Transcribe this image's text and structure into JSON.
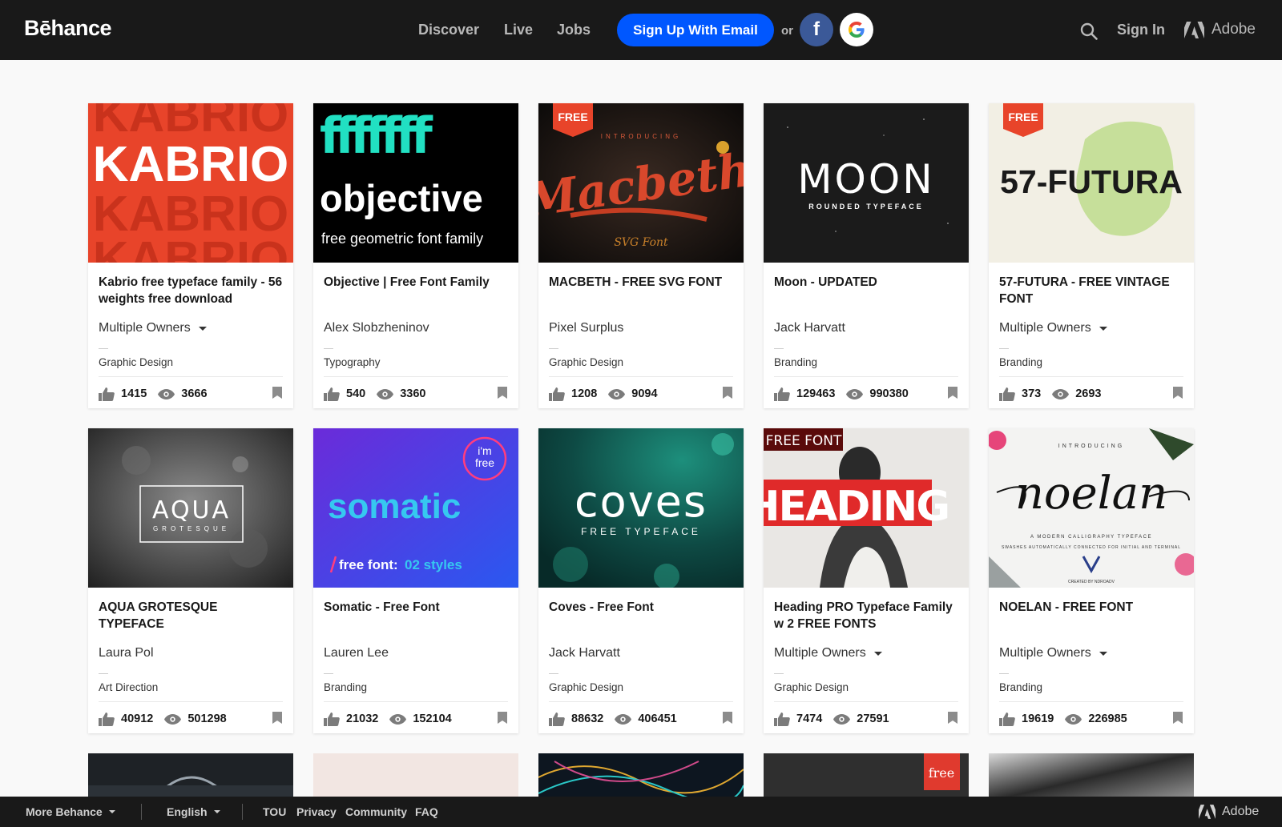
{
  "header": {
    "logo": "Bēhance",
    "nav": [
      "Discover",
      "Live",
      "Jobs"
    ],
    "signup_label": "Sign Up With Email",
    "or_label": "or",
    "facebook_letter": "f",
    "signin_label": "Sign In",
    "adobe_label": "Adobe"
  },
  "projects": [
    {
      "title": "Kabrio free typeface family - 56 weights free download",
      "owner": "Multiple Owners",
      "multiple": true,
      "field": "Graphic Design",
      "likes": "1415",
      "views": "3666",
      "thumb": {
        "lines": [
          "KABRIO"
        ],
        "badge": ""
      }
    },
    {
      "title": "Objective | Free Font Family",
      "owner": "Alex Slobzheninov",
      "multiple": false,
      "field": "Typography",
      "likes": "540",
      "views": "3360",
      "thumb": {
        "lines": [
          "fffffff",
          "objective",
          "free geometric font family"
        ],
        "badge": ""
      }
    },
    {
      "title": "MACBETH - FREE SVG FONT",
      "owner": "Pixel Surplus",
      "multiple": false,
      "field": "Graphic Design",
      "likes": "1208",
      "views": "9094",
      "thumb": {
        "lines": [
          "INTRODUCING",
          "Macbeth",
          "SVG Font"
        ],
        "badge": "FREE"
      }
    },
    {
      "title": "Moon - UPDATED",
      "owner": "Jack Harvatt",
      "multiple": false,
      "field": "Branding",
      "likes": "129463",
      "views": "990380",
      "thumb": {
        "lines": [
          "MOON",
          "ROUNDED TYPEFACE"
        ],
        "badge": ""
      }
    },
    {
      "title": "57-FUTURA - FREE VINTAGE FONT",
      "owner": "Multiple Owners",
      "multiple": true,
      "field": "Branding",
      "likes": "373",
      "views": "2693",
      "thumb": {
        "lines": [
          "57-FUTURA"
        ],
        "badge": "FREE"
      }
    },
    {
      "title": "AQUA GROTESQUE TYPEFACE",
      "owner": "Laura Pol",
      "multiple": false,
      "field": "Art Direction",
      "likes": "40912",
      "views": "501298",
      "thumb": {
        "lines": [
          "AQUA",
          "GROTESQUE"
        ],
        "badge": ""
      }
    },
    {
      "title": "Somatic - Free Font",
      "owner": "Lauren Lee",
      "multiple": false,
      "field": "Branding",
      "likes": "21032",
      "views": "152104",
      "thumb": {
        "lines": [
          "somatic",
          "free font:",
          "02 styles",
          "i'm",
          "free"
        ],
        "badge": ""
      }
    },
    {
      "title": "Coves - Free Font",
      "owner": "Jack Harvatt",
      "multiple": false,
      "field": "Graphic Design",
      "likes": "88632",
      "views": "406451",
      "thumb": {
        "lines": [
          "coves",
          "FREE TYPEFACE"
        ],
        "badge": ""
      }
    },
    {
      "title": "Heading PRO Typeface Family w 2 FREE FONTS",
      "owner": "Multiple Owners",
      "multiple": true,
      "field": "Graphic Design",
      "likes": "7474",
      "views": "27591",
      "thumb": {
        "lines": [
          "HEADING"
        ],
        "badge": "FREE FONT"
      }
    },
    {
      "title": "NOELAN - FREE FONT",
      "owner": "Multiple Owners",
      "multiple": true,
      "field": "Branding",
      "likes": "19619",
      "views": "226985",
      "thumb": {
        "lines": [
          "INTRODUCING",
          "noelan",
          "A MODERN CALLIGRAPHY TYPEFACE",
          "SWASHES AUTOMATICALLY CONNECTED FOR INITIAL AND TERMINAL",
          "CREATED BY NDROADV"
        ],
        "badge": ""
      }
    }
  ],
  "peek": {
    "badge": "free"
  },
  "footer": {
    "more_label": "More Behance",
    "language_label": "English",
    "links": [
      "TOU",
      "Privacy",
      "Community",
      "FAQ"
    ],
    "adobe_label": "Adobe"
  },
  "colors": {
    "brand_blue": "#0057ff",
    "header_bg": "#191919",
    "facebook": "#3b5998"
  }
}
